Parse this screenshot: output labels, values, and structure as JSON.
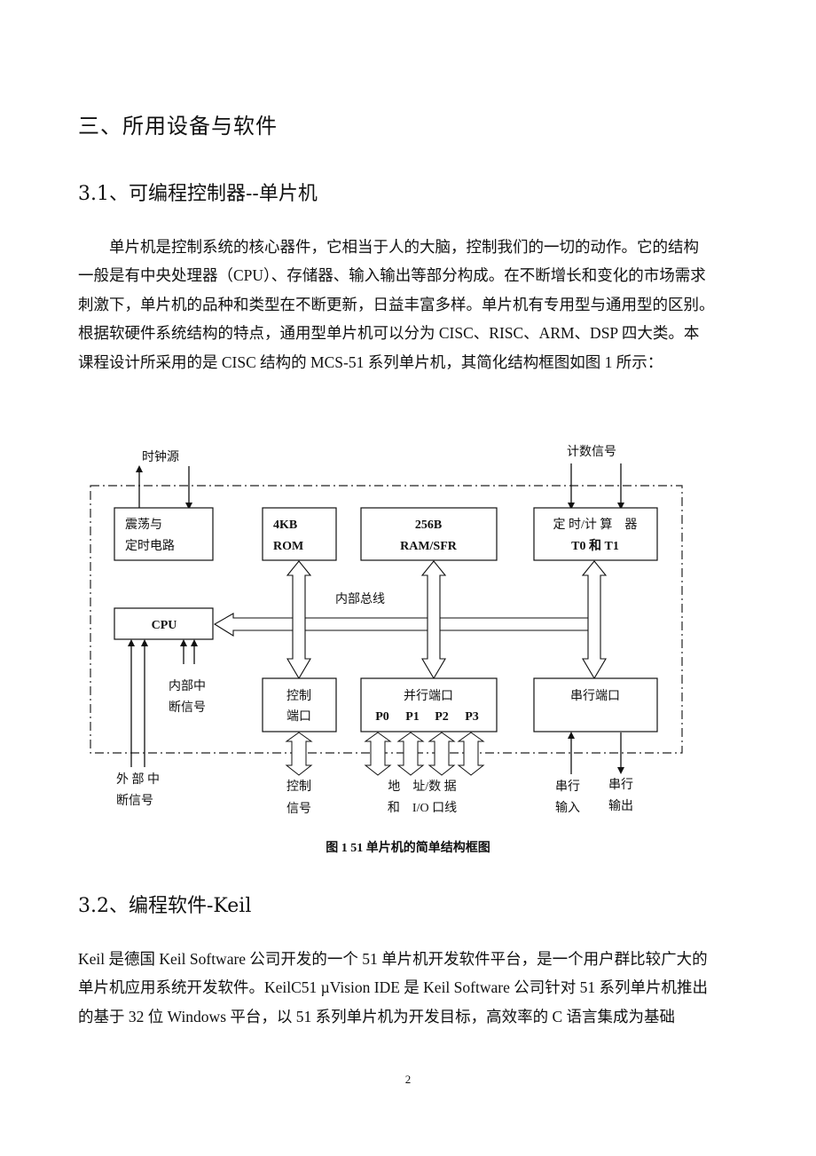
{
  "section_title": "三、所用设备与软件",
  "subsection_1": {
    "title": "3.1、可编程控制器--单片机",
    "paragraph_lines": [
      "单片机是控制系统的核心器件，它相当于人的大脑，控制我们的一切的动作。它的结构",
      "一般是有中央处理器（CPU）、存储器、输入输出等部分构成。在不断增长和变化的市场需求",
      "刺激下，单片机的品种和类型在不断更新，日益丰富多样。单片机有专用型与通用型的区别。",
      "根据软硬件系统结构的特点，通用型单片机可以分为 CISC、RISC、ARM、DSP 四大类。本",
      "课程设计所采用的是 CISC 结构的 MCS-51 系列单片机，其简化结构框图如图 1 所示："
    ]
  },
  "diagram": {
    "clock_source": "时钟源",
    "count_signal": "计数信号",
    "oscillator_block": [
      "震荡与",
      "定时电路"
    ],
    "rom_block": [
      "4KB",
      "ROM"
    ],
    "ram_block": [
      "256B",
      "RAM/SFR"
    ],
    "timer_block": [
      "定 时/计 算　器",
      "T0 和 T1"
    ],
    "internal_bus": "内部总线",
    "cpu_block": "CPU",
    "internal_interrupt": [
      "内部中",
      "断信号"
    ],
    "control_port_block": [
      "控制",
      "端口"
    ],
    "parallel_port_block": "并行端口",
    "ports": [
      "P0",
      "P1",
      "P2",
      "P3"
    ],
    "serial_port_block": "串行端口",
    "external_interrupt": [
      "外 部 中",
      "断信号"
    ],
    "control_signal": [
      "控制",
      "信号"
    ],
    "address_data": [
      "地　址/数 据",
      "和　I/O 口线"
    ],
    "serial_input": [
      "串行",
      "输入"
    ],
    "serial_output": [
      "串行",
      "输出"
    ]
  },
  "figure_caption": "图 1 51 单片机的简单结构框图",
  "subsection_2": {
    "title": "3.2、编程软件-Keil",
    "paragraph_lines": [
      "Keil 是德国 Keil Software 公司开发的一个 51 单片机开发软件平台，是一个用户群比较广大的",
      "单片机应用系统开发软件。KeilC51 µVision IDE 是 Keil Software 公司针对 51 系列单片机推出",
      "的基于 32 位 Windows 平台，以 51 系列单片机为开发目标，高效率的 C 语言集成为基础"
    ]
  },
  "page_number": "2"
}
